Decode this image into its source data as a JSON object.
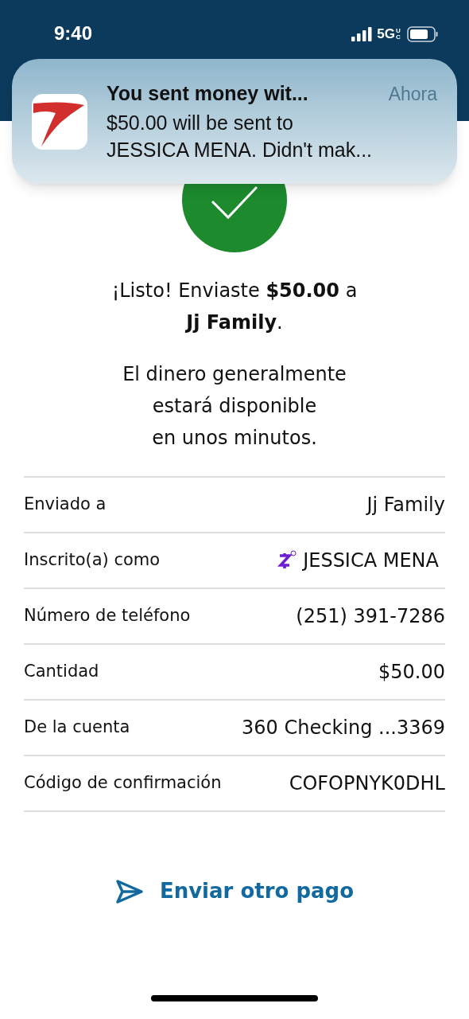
{
  "status_bar": {
    "time": "9:40",
    "network": "5G",
    "network_sub": "UC"
  },
  "notification": {
    "title": "You sent money wit...",
    "time": "Ahora",
    "body": "$50.00 will be sent to\nJESSICA MENA. Didn't mak..."
  },
  "message": "¡Listo! Enviaste **$50.00** a\n**Jj Family**.",
  "note": "El dinero generalmente\nestará disponible\nen unos minutos.",
  "details": [
    {
      "label": "Enviado a",
      "value": "Jj Family",
      "kind": "text"
    },
    {
      "label": "Inscrito(a) como",
      "value": "JESSICA MENA",
      "kind": "zelle"
    },
    {
      "label": "Número de teléfono",
      "value": "(251) 391-7286",
      "kind": "text"
    },
    {
      "label": "Cantidad",
      "value": "$50.00",
      "kind": "text"
    },
    {
      "label": "De la cuenta",
      "value": "360 Checking ...3369",
      "kind": "text"
    },
    {
      "label": "Código de confirmación",
      "value": "COFOPNYK0DHL",
      "kind": "text"
    }
  ],
  "action": {
    "label": "Enviar otro pago"
  }
}
